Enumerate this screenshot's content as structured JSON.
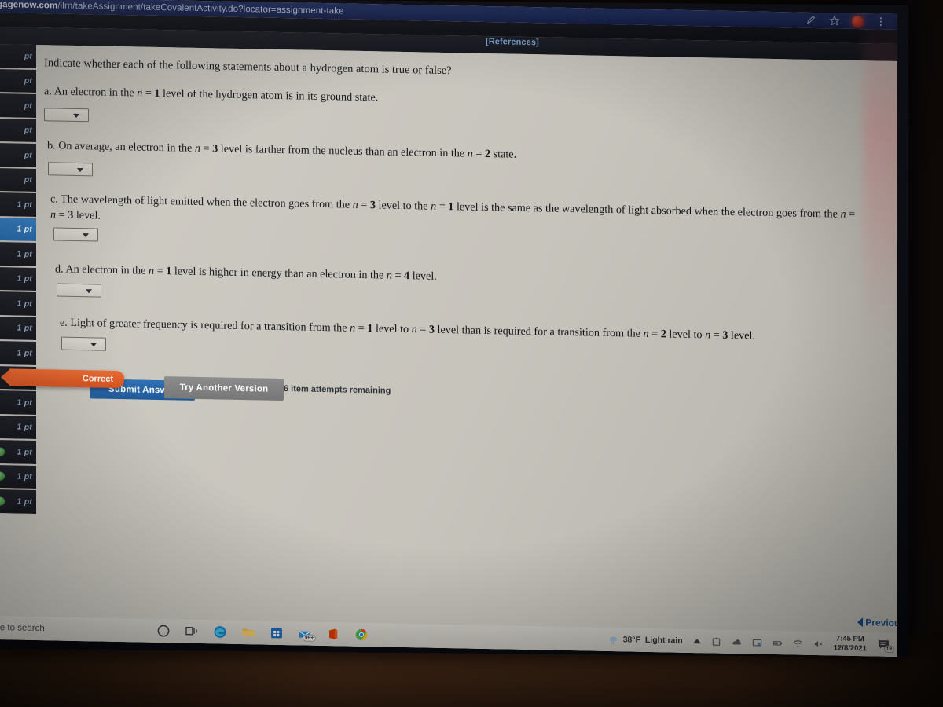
{
  "browser": {
    "url_domain": "gagenow.com",
    "url_path": "/ilrn/takeAssignment/takeCovalentActivity.do?locator=assignment-take",
    "icons": [
      "edit-icon",
      "bookmark-star-icon",
      "profile-avatar",
      "three-dot-menu-icon"
    ]
  },
  "page": {
    "references_link": "[References]",
    "question_intro": "Indicate whether each of the following statements about a hydrogen atom is true or false?",
    "statements": [
      {
        "label": "a.",
        "text_parts": [
          "An electron in the ",
          "n",
          " = ",
          "1",
          " level of the hydrogen atom is in its ground state."
        ],
        "plain": "a. An electron in the n = 1 level of the hydrogen atom is in its ground state.",
        "dropdown_value": ""
      },
      {
        "label": "b.",
        "plain": "b. On average, an electron in the n = 3 level is farther from the nucleus than an electron in the n = 2 state.",
        "dropdown_value": ""
      },
      {
        "label": "c.",
        "plain": "c. The wavelength of light emitted when the electron goes from the n = 3 level to the n = 1 level is the same as the wavelength of light absorbed when the electron goes from the n =",
        "plain_line2": "n = 3 level.",
        "dropdown_value": ""
      },
      {
        "label": "d.",
        "plain": "d. An electron in the n = 1 level is higher in energy than an electron in the n = 4 level.",
        "dropdown_value": ""
      },
      {
        "label": "e.",
        "plain": "e. Light of greater frequency is required for a transition from the n = 1 level to n = 3 level than is required for a transition from the n = 2 level to n = 3 level.",
        "dropdown_value": ""
      }
    ],
    "correct_banner": "Correct",
    "submit_button": "Submit Answer",
    "try_another_button": "Try Another Version",
    "attempts_remaining": "6 item attempts remaining",
    "previous_button": "Previous",
    "accent_blue": "#2a6fb5",
    "accent_orange": "#ef6a2e",
    "accent_gray": "#8c8c8c"
  },
  "sidebar": {
    "items": [
      {
        "label": "pt",
        "active": false,
        "check": false
      },
      {
        "label": "pt",
        "active": false,
        "check": false
      },
      {
        "label": "pt",
        "active": false,
        "check": false
      },
      {
        "label": "pt",
        "active": false,
        "check": false
      },
      {
        "label": "pt",
        "active": false,
        "check": false
      },
      {
        "label": "pt",
        "active": false,
        "check": false
      },
      {
        "label": "1 pt",
        "active": false,
        "check": false
      },
      {
        "label": "1 pt",
        "active": true,
        "check": false
      },
      {
        "label": "1 pt",
        "active": false,
        "check": false
      },
      {
        "label": "1 pt",
        "active": false,
        "check": false
      },
      {
        "label": "1 pt",
        "active": false,
        "check": false
      },
      {
        "label": "1 pt",
        "active": false,
        "check": false
      },
      {
        "label": "1 pt",
        "active": false,
        "check": false
      },
      {
        "label": "1 pt",
        "active": false,
        "check": false
      },
      {
        "label": "1 pt",
        "active": false,
        "check": false
      },
      {
        "label": "1 pt",
        "active": false,
        "check": false
      },
      {
        "label": "1 pt",
        "active": false,
        "check": true
      },
      {
        "label": "1 pt",
        "active": false,
        "check": true
      },
      {
        "label": "1 pt",
        "active": false,
        "check": true
      }
    ]
  },
  "taskbar": {
    "search_placeholder": "re to search",
    "app_icons": [
      "cortana-circle-icon",
      "task-view-icon",
      "edge-browser-icon",
      "file-explorer-icon",
      "microsoft-store-icon",
      "mail-icon",
      "office-icon",
      "chrome-browser-icon"
    ],
    "mail_badge": "99+",
    "weather_temp": "38°F",
    "weather_condition": "Light rain",
    "tray_icons": [
      "chevron-up-icon",
      "onedrive-sync-icon",
      "dropbox-icon",
      "display-icon",
      "battery-icon",
      "wifi-icon",
      "volume-muted-icon"
    ],
    "clock_time": "7:45 PM",
    "clock_date": "12/8/2021",
    "notification_count": "19"
  }
}
